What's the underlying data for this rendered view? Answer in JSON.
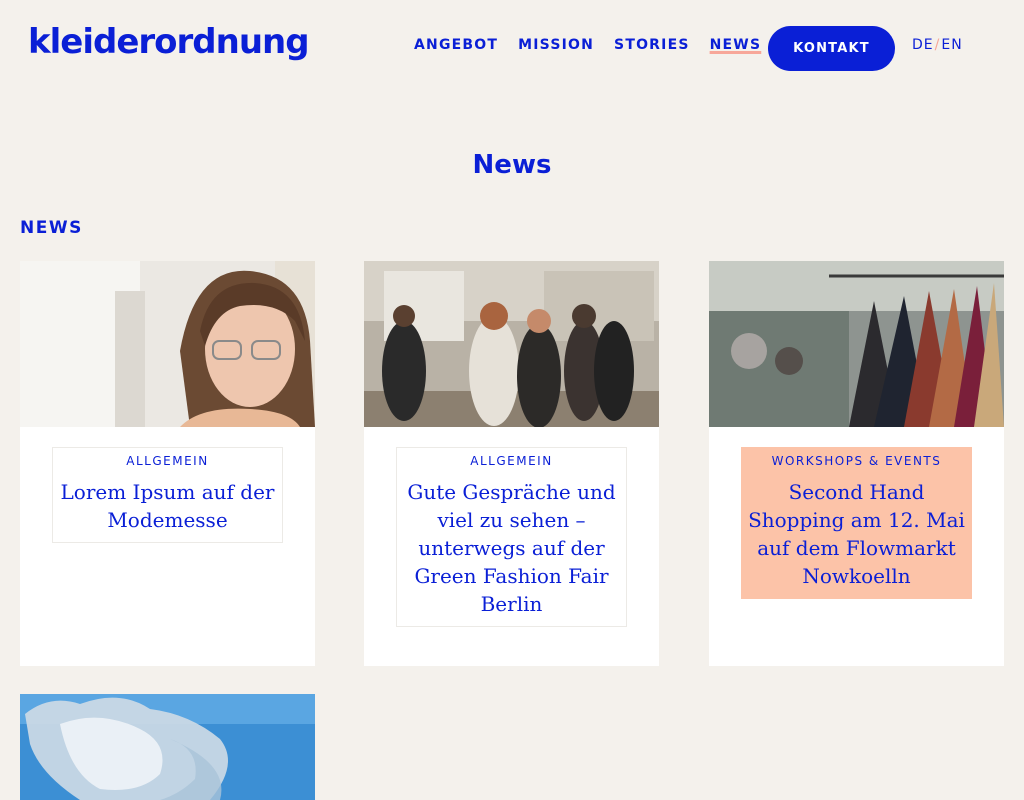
{
  "header": {
    "logo": "kleiderordnung",
    "nav": [
      "ANGEBOT",
      "MISSION",
      "STORIES",
      "NEWS"
    ],
    "active_nav": "NEWS",
    "kontakt": "KONTAKT",
    "lang_de": "DE",
    "lang_sep": "/",
    "lang_en": "EN"
  },
  "page": {
    "title": "News",
    "section_label": "NEWS"
  },
  "cards": [
    {
      "category": "ALLGEMEIN",
      "title": "Lorem Ipsum auf der Modemesse"
    },
    {
      "category": "ALLGEMEIN",
      "title": "Gute Gespräche und viel zu sehen – unterwegs auf der Green Fashion Fair Berlin"
    },
    {
      "category": "WORKSHOPS & EVENTS",
      "title": "Second Hand Shopping am 12. Mai auf dem Flowmarkt Nowkoelln"
    }
  ],
  "colors": {
    "accent": "#0a1fd6",
    "highlight": "#fcc3a8",
    "background": "#f4f1ec"
  }
}
